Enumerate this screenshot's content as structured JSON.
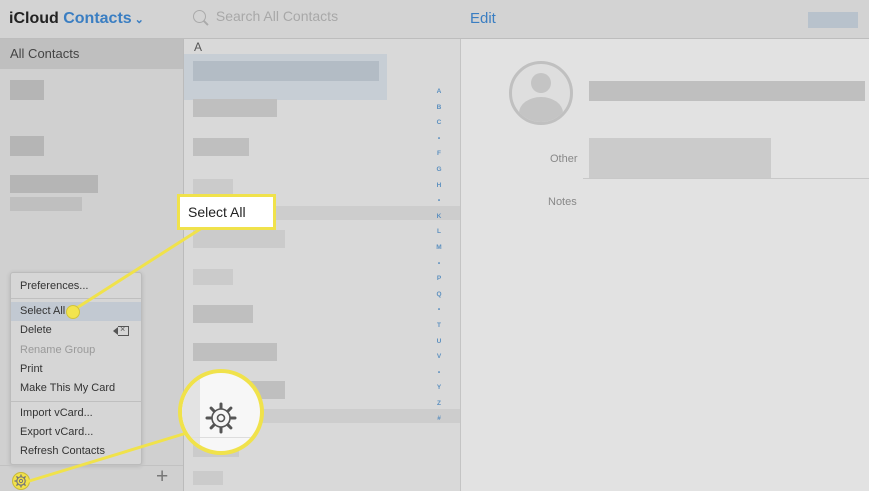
{
  "header": {
    "app_name": "iCloud",
    "app_section": "Contacts",
    "section_chevron": "⌄",
    "search_placeholder": "Search All Contacts",
    "edit_label": "Edit"
  },
  "sidebar": {
    "all_contacts_label": "All Contacts",
    "add_button_label": "+"
  },
  "list": {
    "section_header": "A",
    "index_letters": [
      "A",
      "B",
      "C",
      "•",
      "F",
      "G",
      "H",
      "•",
      "K",
      "L",
      "M",
      "•",
      "P",
      "Q",
      "•",
      "T",
      "U",
      "V",
      "•",
      "Y",
      "Z",
      "#"
    ]
  },
  "detail": {
    "other_label": "Other",
    "notes_label": "Notes"
  },
  "settings_menu": {
    "items": [
      {
        "label": "Preferences...",
        "enabled": true,
        "highlighted": false
      },
      {
        "label": "Select All",
        "enabled": true,
        "highlighted": true
      },
      {
        "label": "Delete",
        "enabled": true,
        "highlighted": false
      },
      {
        "label": "Rename Group",
        "enabled": false,
        "highlighted": false
      },
      {
        "label": "Print",
        "enabled": true,
        "highlighted": false
      },
      {
        "label": "Make This My Card",
        "enabled": true,
        "highlighted": false
      },
      {
        "label": "Import vCard...",
        "enabled": true,
        "highlighted": false
      },
      {
        "label": "Export vCard...",
        "enabled": true,
        "highlighted": false
      },
      {
        "label": "Refresh Contacts",
        "enabled": true,
        "highlighted": false
      }
    ]
  },
  "callout": {
    "label": "Select All"
  },
  "icons": {
    "settings": "gear-icon",
    "delete": "delete-backspace-icon",
    "search": "search-icon",
    "avatar": "person-icon"
  },
  "colors": {
    "accent": "#3a7ec2",
    "callout_yellow": "#f0e24b"
  }
}
